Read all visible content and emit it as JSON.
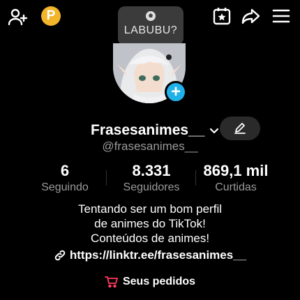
{
  "header": {
    "bubble_text": "LABUBU?",
    "coin_label": "P"
  },
  "profile": {
    "username": "Frasesanimes__",
    "handle": "@frasesanimes__",
    "plus_label": "+"
  },
  "stats": [
    {
      "value": "6",
      "label": "Seguindo"
    },
    {
      "value": "8.331",
      "label": "Seguidores"
    },
    {
      "value": "869,1 mil",
      "label": "Curtidas"
    }
  ],
  "bio": {
    "line1": "Tentando ser um bom perfil",
    "line2": "de animes do TikTok!",
    "line3": "Conteúdos de animes!"
  },
  "link": "https://linktr.ee/frasesanimes__",
  "orders_label": "Seus pedidos",
  "colors": {
    "background": "#000000",
    "accent_blue": "#1fb1e8",
    "coin_yellow": "#f3b52a",
    "orders_red": "#ff3b5c",
    "muted_text": "#9a9a9a"
  },
  "icons": [
    "add-user-icon",
    "coin-icon",
    "star-calendar-icon",
    "share-icon",
    "menu-icon",
    "soccer-ball-icon",
    "chevron-down-icon",
    "edit-pencil-icon",
    "link-icon",
    "cart-icon"
  ]
}
